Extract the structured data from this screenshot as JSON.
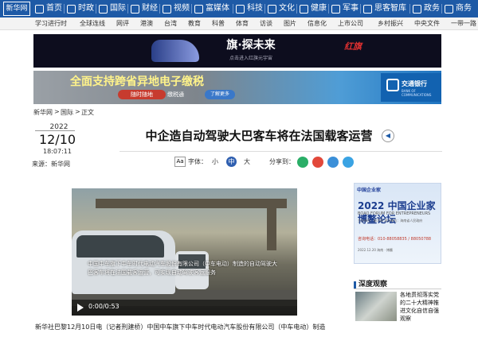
{
  "site": {
    "logo": "新华网"
  },
  "nav": {
    "items": [
      "首页",
      "时政",
      "国际",
      "财经",
      "视频",
      "富媒体",
      "科技",
      "文化",
      "健康",
      "军事",
      "思客智库",
      "政务",
      "商务"
    ],
    "sub_items": [
      "学习进行时",
      "全球连线",
      "网评",
      "港澳",
      "台湾",
      "教育",
      "科普",
      "体育",
      "访谈",
      "图片",
      "信息化",
      "上市公司",
      "乡村振兴",
      "中央文件",
      "一带一路"
    ]
  },
  "banner1": {
    "title": "旗·探未来",
    "subtitle": "点击进入红旗元宇宙",
    "brand": "红旗"
  },
  "banner2": {
    "title": "全面支持跨省异地电子缴税",
    "pill1": "随时随地",
    "pill2": "缴税通",
    "pill3": "了解更多",
    "bank_name": "交通银行",
    "bank_en": "BANK OF COMMUNICATIONS"
  },
  "breadcrumb": {
    "home": "新华网",
    "sep1": ">",
    "section": "国际",
    "sep2": ">",
    "current": "正文"
  },
  "article": {
    "year": "2022",
    "date": "12/10",
    "time": "18:07:11",
    "source": "来源：新华网",
    "title": "中企造自动驾驶大巴客车将在法国载客运营",
    "font_label": "字体：",
    "font_small": "小",
    "font_mid": "中",
    "font_large": "大",
    "share_label": "分享到：",
    "body_first_line": "新华社巴黎12月10日电（记者刑建桥）中国中车旗下中车时代电动汽车股份有限公司（中车电动）制造"
  },
  "video": {
    "caption": "中国中车旗下中车时代电动汽车股份有限公司（中车电动）制造的自动驾驶大巴客车将在法国载客运营，可实现自动驾驶客运服务",
    "time": "0:00/0:53"
  },
  "ad": {
    "logo": "中国企业家",
    "title": "2022 中国企业家博鳌论坛",
    "subtitle": "BOAO FORUM FOR ENTREPRENEURS",
    "lines": "主办单位：新华网  承办单位：海南省人民政府",
    "phone": "咨询电话：010-88058835 / 88050788",
    "footer": "2022.12.20 海南 · 博鳌"
  },
  "deep": {
    "title": "深度观察",
    "headline": "各地贯彻落实党的二十大精神推进文化自信自强观察"
  },
  "colors": {
    "nav_bg": "#1e5aa6",
    "accent": "#2f5fb0"
  }
}
